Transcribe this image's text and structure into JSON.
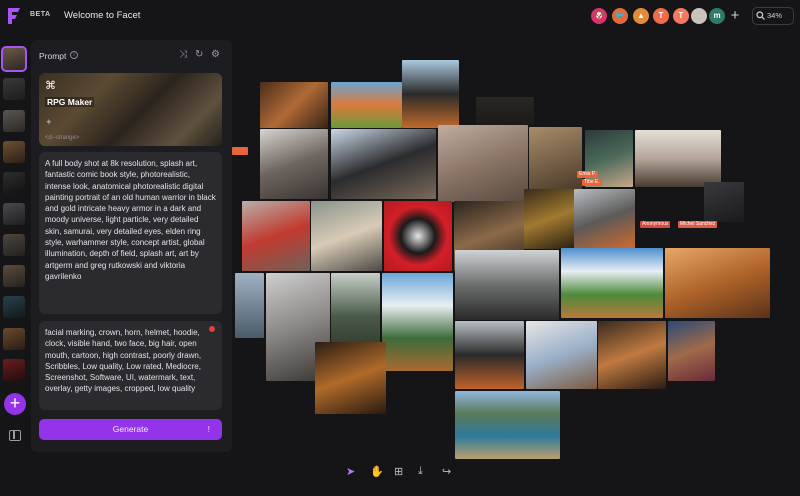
{
  "header": {
    "title": "Welcome to Facet",
    "beta_label": "BETA",
    "zoom_label": "34%",
    "avatars": [
      {
        "kind": "avatar-dog",
        "color": "#d8336a",
        "letter": ""
      },
      {
        "kind": "avatar-bird",
        "color": "#e06a3b",
        "letter": ""
      },
      {
        "kind": "avatar-landscape",
        "color": "#e28b3a",
        "letter": ""
      },
      {
        "kind": "avatar-letter",
        "color": "#f06b4a",
        "letter": "T"
      },
      {
        "kind": "avatar-letter",
        "color": "#f2795f",
        "letter": "T"
      },
      {
        "kind": "avatar-photo",
        "color": "#c9c2bd",
        "letter": ""
      },
      {
        "kind": "avatar-letter",
        "color": "#2f7a6b",
        "letter": "m"
      }
    ]
  },
  "prompt_panel": {
    "title": "Prompt",
    "style_card": {
      "label": "RPG Maker",
      "tag": "<d--strange>"
    },
    "prompt_text": "A full body shot at 8k resolution, splash art, fantastic comic book style, photorealistic, intense look, anatomical photorealistic digital painting portrait of an old human warrior in black and gold intricate heavy armor in a dark and moody universe, light particle, very detailed skin, samurai, very detailed eyes, elden ring style, warhammer style, concept artist, global illumination, depth of field, splash art, art by artgerm and greg rutkowski and viktoria gavrilenko",
    "negative_prompt": "facial marking, crown, horn, helmet, hoodie, clock, visible hand, two face, big hair, open mouth, cartoon, high contrast, poorly drawn, Scribbles, Low quality, Low rated, Mediocre, Screenshot, Software, UI, watermark, text, overlay, getty images, cropped, low quality",
    "generate_label": "Generate",
    "generate_hint": "!"
  },
  "canvas": {
    "badges": [
      {
        "text": "Emia P.",
        "color": "#e8643b"
      },
      {
        "text": "Tibe E.",
        "color": "#e8643b"
      },
      {
        "text": "Anonymous",
        "color": "#d9483c"
      },
      {
        "text": "Michel Sanchez",
        "color": "#e05a46"
      }
    ]
  },
  "colors": {
    "accent": "#9333ea",
    "background": "#151517",
    "panel": "#1d1d21"
  },
  "toolbar": {
    "tools": [
      "select-cursor",
      "hand",
      "add-image",
      "download",
      "share"
    ]
  }
}
